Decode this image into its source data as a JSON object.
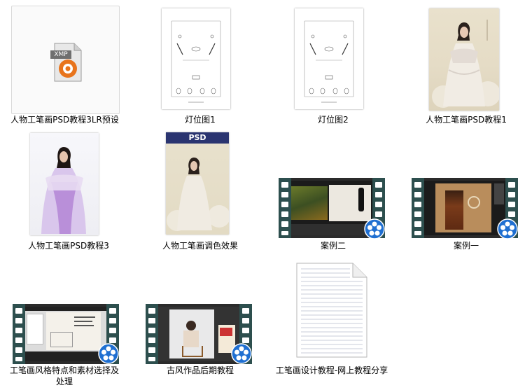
{
  "files": [
    {
      "name": "人物工笔画PSD教程3LR预设",
      "type": "xmp",
      "icon_text": "XMP"
    },
    {
      "name": "灯位图1",
      "type": "diagram"
    },
    {
      "name": "灯位图2",
      "type": "diagram"
    },
    {
      "name": "人物工笔画PSD教程1",
      "type": "photo"
    },
    {
      "name": "人物工笔画PSD教程3",
      "type": "photo"
    },
    {
      "name": "人物工笔画调色效果",
      "type": "photo",
      "banner_text": "PSD"
    },
    {
      "name": "案例二",
      "type": "video"
    },
    {
      "name": "案例一",
      "type": "video"
    },
    {
      "name": "工笔画风格特点和素材选择及处理",
      "type": "video"
    },
    {
      "name": "古风作品后期教程",
      "type": "video"
    },
    {
      "name": "工笔画设计教程-网上教程分享",
      "type": "text"
    }
  ],
  "colors": {
    "xmp_orange": "#e8741c",
    "film_frame": "#2d4f4e",
    "reel_blue": "#1f6fd1",
    "psd_banner": "#2a3470"
  },
  "icons": {
    "xmp": "xmp-file-icon",
    "video": "video-reel-icon",
    "text": "text-document-icon"
  }
}
